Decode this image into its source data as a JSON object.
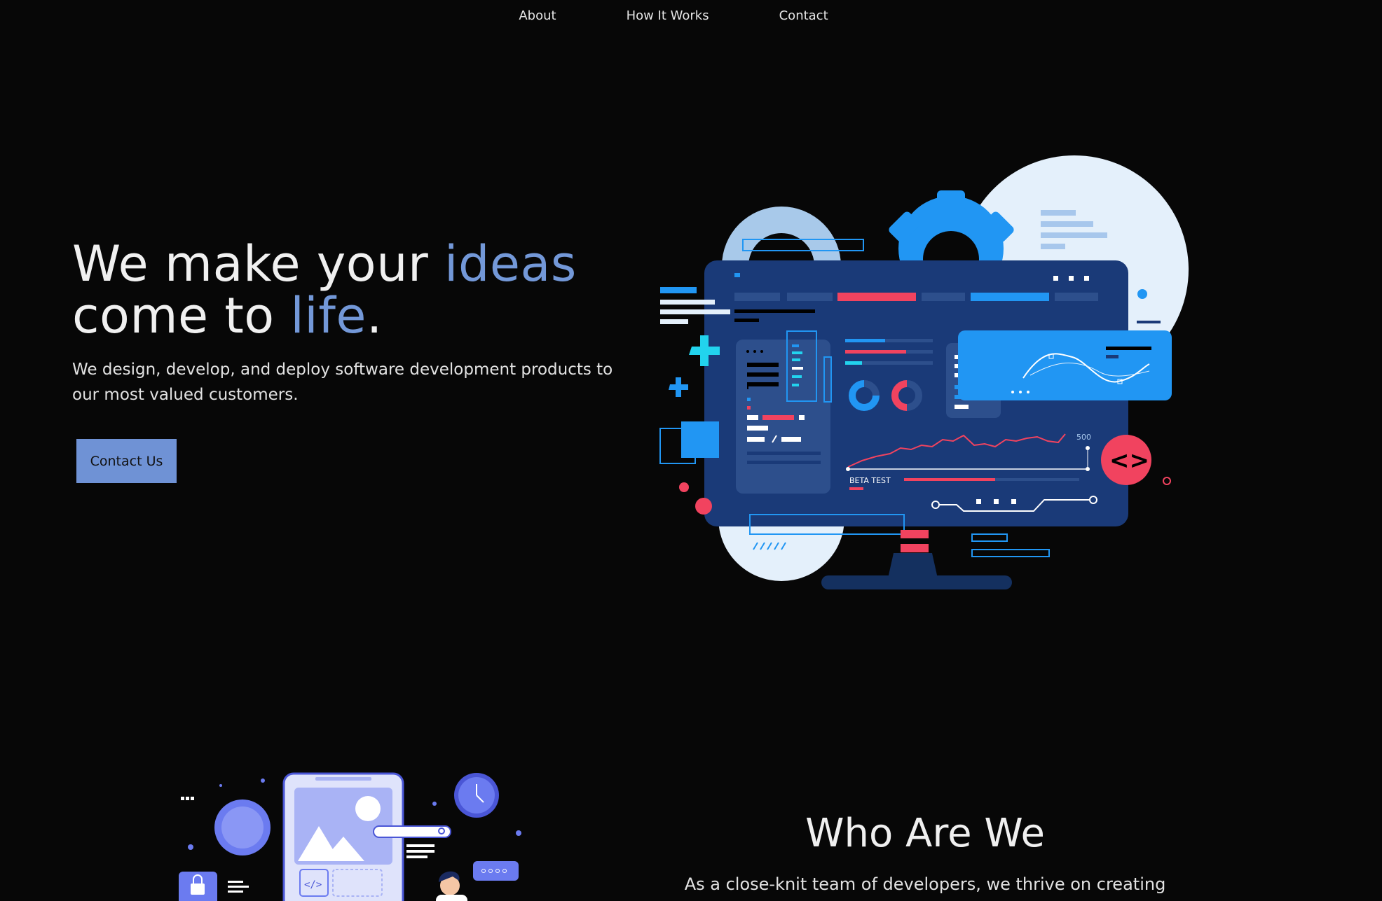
{
  "nav": {
    "items": [
      {
        "label": "About"
      },
      {
        "label": "How It Works"
      },
      {
        "label": "Contact"
      }
    ]
  },
  "hero": {
    "title_part1": "We make your ",
    "title_accent1": "ideas",
    "title_part2": "come to ",
    "title_accent2": "life",
    "title_period": ".",
    "subtitle": "We design, develop, and deploy software development products to our most valued customers.",
    "cta_label": "Contact Us",
    "illustration": {
      "chart_label": "BETA TEST",
      "chart_max": "500",
      "code_badge": "<>"
    }
  },
  "who": {
    "title": "Who Are We",
    "description": "As a close-knit team of developers, we thrive on creating user-"
  },
  "colors": {
    "accent": "#7398d8",
    "button": "#6f92d5",
    "background": "#070707",
    "monitor": "#1a3a78",
    "highlight_red": "#f1435f",
    "highlight_blue": "#2196f3"
  }
}
